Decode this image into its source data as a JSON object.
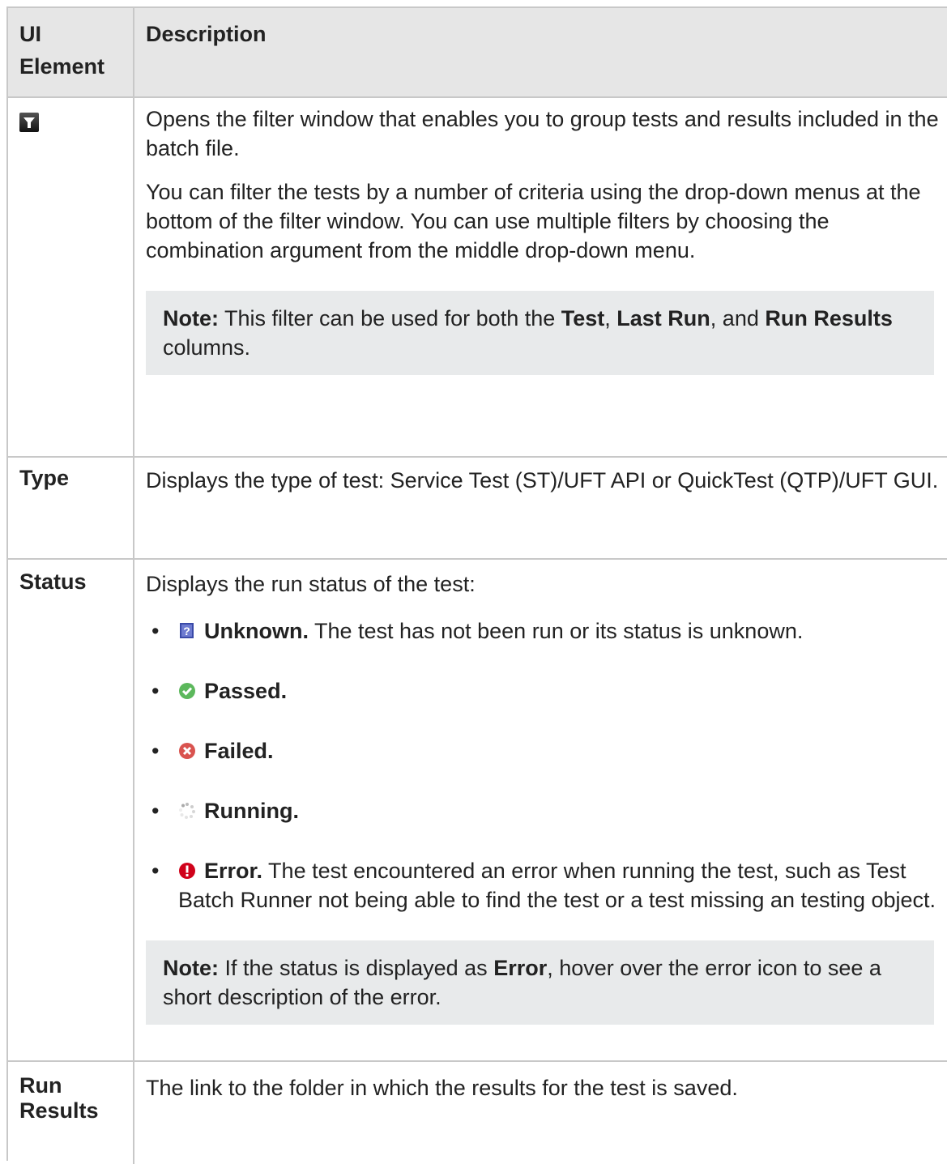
{
  "header": {
    "col1": "UI Element",
    "col2": "Description"
  },
  "rows": {
    "filter": {
      "icon": "filter-icon",
      "p1": "Opens the filter window that enables you to group tests and results included in the batch file.",
      "p2": "You can filter the tests by a number of criteria using the drop-down menus at the bottom of the filter window. You can use multiple filters by choosing the combination argument from the middle drop-down menu.",
      "note_label": "Note:",
      "note_t1": " This filter can be used for both the ",
      "note_b1": "Test",
      "note_t2": ", ",
      "note_b2": "Last Run",
      "note_t3": ", and ",
      "note_b3": "Run Results",
      "note_t4": " columns."
    },
    "type": {
      "label": "Type",
      "desc": "Displays the type of test: Service Test (ST)/UFT API or QuickTest (QTP)/UFT GUI."
    },
    "status": {
      "label": "Status",
      "intro": "Displays the run status of the test:",
      "items": [
        {
          "icon": "unknown-icon",
          "label": "Unknown.",
          "text": " The test has not been run or its status is unknown."
        },
        {
          "icon": "passed-icon",
          "label": "Passed.",
          "text": ""
        },
        {
          "icon": "failed-icon",
          "label": "Failed.",
          "text": ""
        },
        {
          "icon": "running-icon",
          "label": "Running.",
          "text": ""
        },
        {
          "icon": "error-icon",
          "label": "Error.",
          "text": " The test encountered an error when running the test, such as Test Batch Runner not being able to find the test or a test missing an testing object."
        }
      ],
      "note_label": "Note:",
      "note_t1": " If the status is displayed as ",
      "note_b1": "Error",
      "note_t2": ", hover over the error icon to see a short description of the error."
    },
    "run_results": {
      "label": "Run Results",
      "desc": "The link to the folder in which the results for the test is saved."
    }
  },
  "colors": {
    "border": "#c8c8c8",
    "header_bg": "#e6e6e6",
    "note_bg": "#e8eaeb",
    "passed": "#5cb85c",
    "failed": "#d9534f",
    "error": "#d0021b"
  }
}
